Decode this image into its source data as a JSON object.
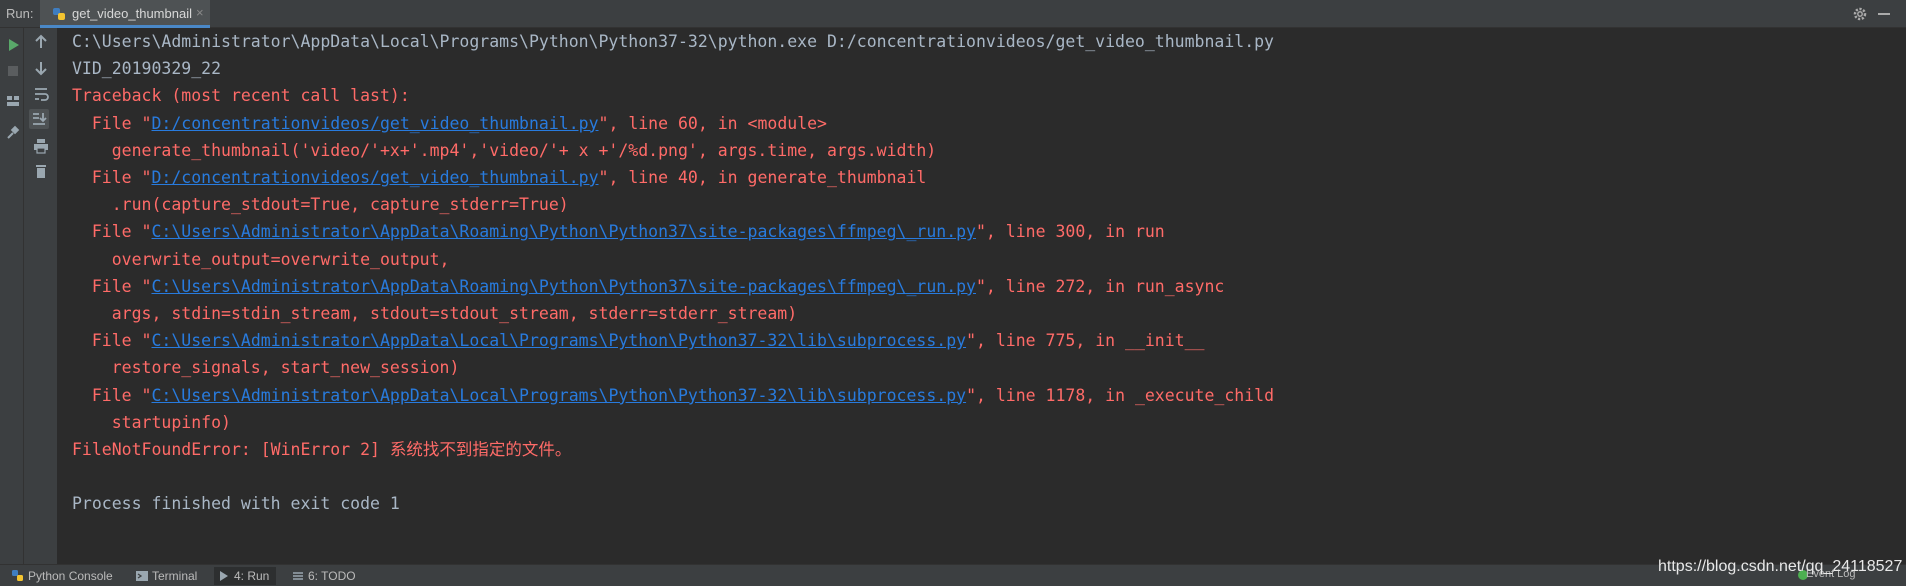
{
  "toolwindow": {
    "label": "Run:",
    "tab": {
      "name": "get_video_thumbnail",
      "close": "×",
      "icon": "python-icon"
    }
  },
  "console": {
    "lines": [
      {
        "type": "normal",
        "text": "C:\\Users\\Administrator\\AppData\\Local\\Programs\\Python\\Python37-32\\python.exe D:/concentrationvideos/get_video_thumbnail.py"
      },
      {
        "type": "normal",
        "text": "VID_20190329_22"
      },
      {
        "type": "error",
        "text": "Traceback (most recent call last):"
      },
      {
        "type": "error",
        "pre": "  File \"",
        "link": "D:/concentrationvideos/get_video_thumbnail.py",
        "post": "\", line 60, in <module>"
      },
      {
        "type": "error",
        "text": "    generate_thumbnail('video/'+x+'.mp4','video/'+ x +'/%d.png', args.time, args.width)"
      },
      {
        "type": "error",
        "pre": "  File \"",
        "link": "D:/concentrationvideos/get_video_thumbnail.py",
        "post": "\", line 40, in generate_thumbnail"
      },
      {
        "type": "error",
        "text": "    .run(capture_stdout=True, capture_stderr=True)"
      },
      {
        "type": "error",
        "pre": "  File \"",
        "link": "C:\\Users\\Administrator\\AppData\\Roaming\\Python\\Python37\\site-packages\\ffmpeg\\_run.py",
        "post": "\", line 300, in run"
      },
      {
        "type": "error",
        "text": "    overwrite_output=overwrite_output,"
      },
      {
        "type": "error",
        "pre": "  File \"",
        "link": "C:\\Users\\Administrator\\AppData\\Roaming\\Python\\Python37\\site-packages\\ffmpeg\\_run.py",
        "post": "\", line 272, in run_async"
      },
      {
        "type": "error",
        "text": "    args, stdin=stdin_stream, stdout=stdout_stream, stderr=stderr_stream)"
      },
      {
        "type": "error",
        "pre": "  File \"",
        "link": "C:\\Users\\Administrator\\AppData\\Local\\Programs\\Python\\Python37-32\\lib\\subprocess.py",
        "post": "\", line 775, in __init__"
      },
      {
        "type": "error",
        "text": "    restore_signals, start_new_session)"
      },
      {
        "type": "error",
        "pre": "  File \"",
        "link": "C:\\Users\\Administrator\\AppData\\Local\\Programs\\Python\\Python37-32\\lib\\subprocess.py",
        "post": "\", line 1178, in _execute_child"
      },
      {
        "type": "error",
        "text": "    startupinfo)"
      },
      {
        "type": "error",
        "text": "FileNotFoundError: [WinError 2] 系统找不到指定的文件。"
      },
      {
        "type": "normal",
        "text": ""
      },
      {
        "type": "normal",
        "text": "Process finished with exit code 1"
      }
    ]
  },
  "bottom_tabs": [
    {
      "label": "Python Console",
      "icon": "python-console-icon"
    },
    {
      "label": "Terminal",
      "icon": "terminal-icon"
    },
    {
      "label": "4: Run",
      "icon": "run-icon",
      "active": true
    },
    {
      "label": "6: TODO",
      "icon": "todo-icon"
    }
  ],
  "event_log": "Event Log",
  "watermark": "https://blog.csdn.net/qq_24118527",
  "colors": {
    "background": "#2b2b2b",
    "toolbar": "#3c3f41",
    "error": "#ff6b68",
    "link": "#287bde",
    "normal_text": "#a9b7c6",
    "run_green": "#59a869"
  }
}
